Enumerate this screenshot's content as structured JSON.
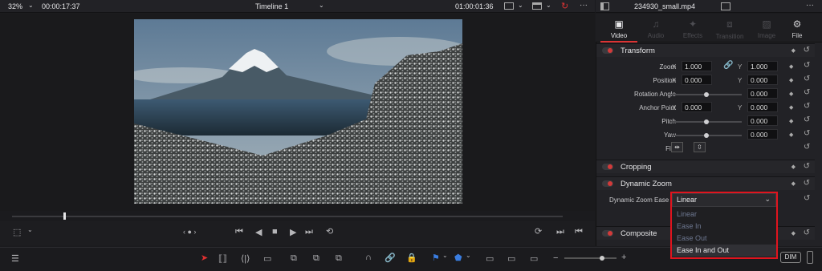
{
  "topbar": {
    "zoom": "32%",
    "timecode": "00:00:17:37",
    "timeline_name": "Timeline 1",
    "timeline_time": "01:00:01:36"
  },
  "inspector": {
    "clip_name": "234930_small.mp4",
    "tabs": [
      "Video",
      "Audio",
      "Effects",
      "Transition",
      "Image",
      "File"
    ],
    "active_tab": "Video"
  },
  "transform": {
    "title": "Transform",
    "zoom_label": "Zoom",
    "zoom_x": "1.000",
    "zoom_y": "1.000",
    "position_label": "Position",
    "position_x": "0.000",
    "position_y": "0.000",
    "rotation_label": "Rotation Angle",
    "rotation": "0.000",
    "anchor_label": "Anchor Point",
    "anchor_x": "0.000",
    "anchor_y": "0.000",
    "pitch_label": "Pitch",
    "pitch": "0.000",
    "yaw_label": "Yaw",
    "yaw": "0.000",
    "flip_label": "Flip",
    "x_axis": "X",
    "y_axis": "Y"
  },
  "cropping": {
    "title": "Cropping"
  },
  "dynamic_zoom": {
    "title": "Dynamic Zoom",
    "ease_label": "Dynamic Zoom Ease",
    "ease_value": "Linear",
    "options": [
      "Linear",
      "Ease In",
      "Ease Out",
      "Ease In and Out"
    ],
    "highlighted": "Ease In and Out"
  },
  "composite": {
    "title": "Composite"
  },
  "bottom": {
    "dim": "DIM"
  },
  "colors": {
    "accent": "#e0141e",
    "panel": "#222226"
  }
}
